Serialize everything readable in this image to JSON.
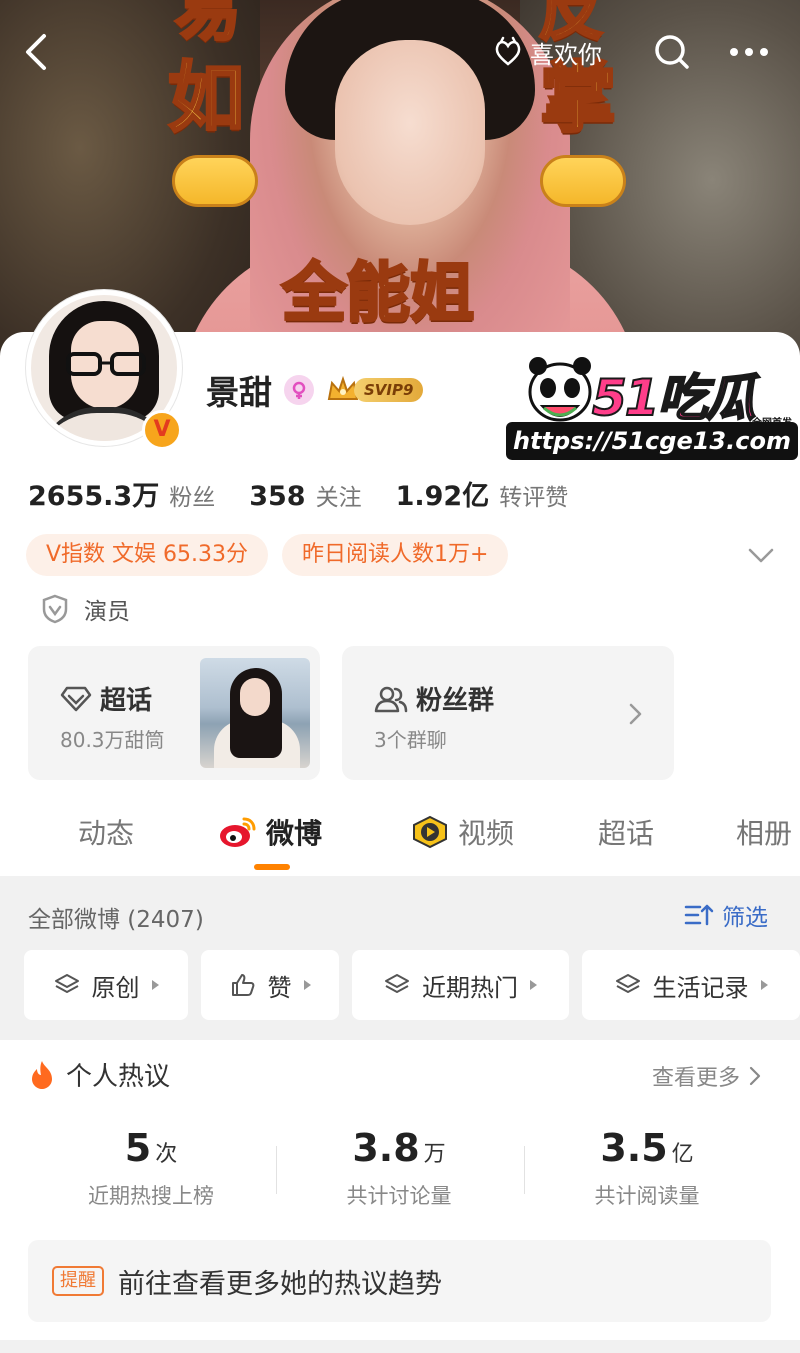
{
  "banner": {
    "poster_lines": [
      "易",
      "如",
      "反",
      "掌",
      "全能姐"
    ],
    "like_label": "喜欢你"
  },
  "profile": {
    "name": "景甜",
    "svip_label": "SVIP9",
    "stats": [
      {
        "value": "2655.3万",
        "label": "粉丝"
      },
      {
        "value": "358",
        "label": "关注"
      },
      {
        "value": "1.92亿",
        "label": "转评赞"
      }
    ],
    "tags": [
      "V指数 文娱 65.33分",
      "昨日阅读人数1万+"
    ],
    "verification": "演员"
  },
  "watermark": {
    "brand": "51吃瓜",
    "tag": "全网首发",
    "url": "https://51cge13.com"
  },
  "cards": {
    "super_topic": {
      "title": "超话",
      "sub": "80.3万甜筒"
    },
    "fan_group": {
      "title": "粉丝群",
      "sub": "3个群聊"
    }
  },
  "tabs": [
    {
      "label": "动态"
    },
    {
      "label": "微博"
    },
    {
      "label": "视频"
    },
    {
      "label": "超话"
    },
    {
      "label": "相册"
    }
  ],
  "feed": {
    "header": "全部微博 (2407)",
    "filter_label": "筛选",
    "chips": [
      "原创",
      "赞",
      "近期热门",
      "生活记录"
    ]
  },
  "hot": {
    "title": "个人热议",
    "see_more": "查看更多",
    "stats": [
      {
        "value": "5",
        "unit": "次",
        "label": "近期热搜上榜"
      },
      {
        "value": "3.8",
        "unit": "万",
        "label": "共计讨论量"
      },
      {
        "value": "3.5",
        "unit": "亿",
        "label": "共计阅读量"
      }
    ],
    "reminder_badge": "提醒",
    "reminder_text": "前往查看更多她的热议趋势"
  },
  "colors": {
    "accent": "#ff8200",
    "tag_text": "#f06a2a",
    "tag_bg": "#fdf0e8",
    "link_blue": "#3a6cc7",
    "watermark_pink": "#ff3e8a"
  },
  "icons": [
    "back-arrow-icon",
    "heart-hands-icon",
    "search-icon",
    "more-dots-icon",
    "female-icon",
    "crown-icon",
    "verified-v-icon",
    "chevron-down-icon",
    "shield-icon",
    "diamond-icon",
    "people-icon",
    "chevron-right-icon",
    "weibo-eye-icon",
    "video-play-icon",
    "filter-icon",
    "layers-icon",
    "thumbs-up-icon",
    "flame-icon"
  ]
}
